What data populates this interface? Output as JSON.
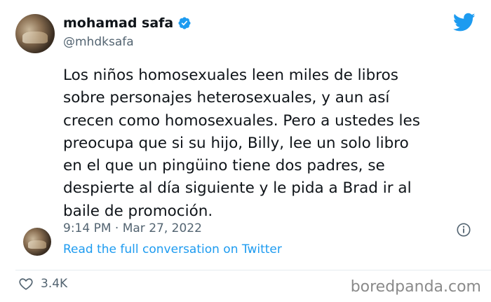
{
  "author": {
    "display_name": "mohamad safa",
    "handle": "@mhdksafa",
    "verified": true
  },
  "tweet": {
    "lines": [
      "Los niños homosexuales leen miles de libros",
      "sobre personajes heterosexuales, y aun así",
      "crecen como homosexuales. Pero a ustedes les",
      "preocupa que si su hijo, Billy, lee un solo libro",
      "en el que un pingüino tiene dos padres, se",
      "despierte al día siguiente y le pida a Brad ir al",
      "baile de promoción."
    ],
    "timestamp": "9:14 PM · Mar 27, 2022"
  },
  "conversation_link": "Read the full conversation on Twitter",
  "likes": {
    "count": "3.4K"
  },
  "watermark": "boredpanda.com",
  "colors": {
    "text": "#0f1419",
    "secondary": "#536471",
    "accent": "#1d9bf0"
  },
  "icons": {
    "verified": "verified-badge-icon",
    "brand": "twitter-bird-icon",
    "info": "info-icon",
    "like": "heart-icon"
  }
}
